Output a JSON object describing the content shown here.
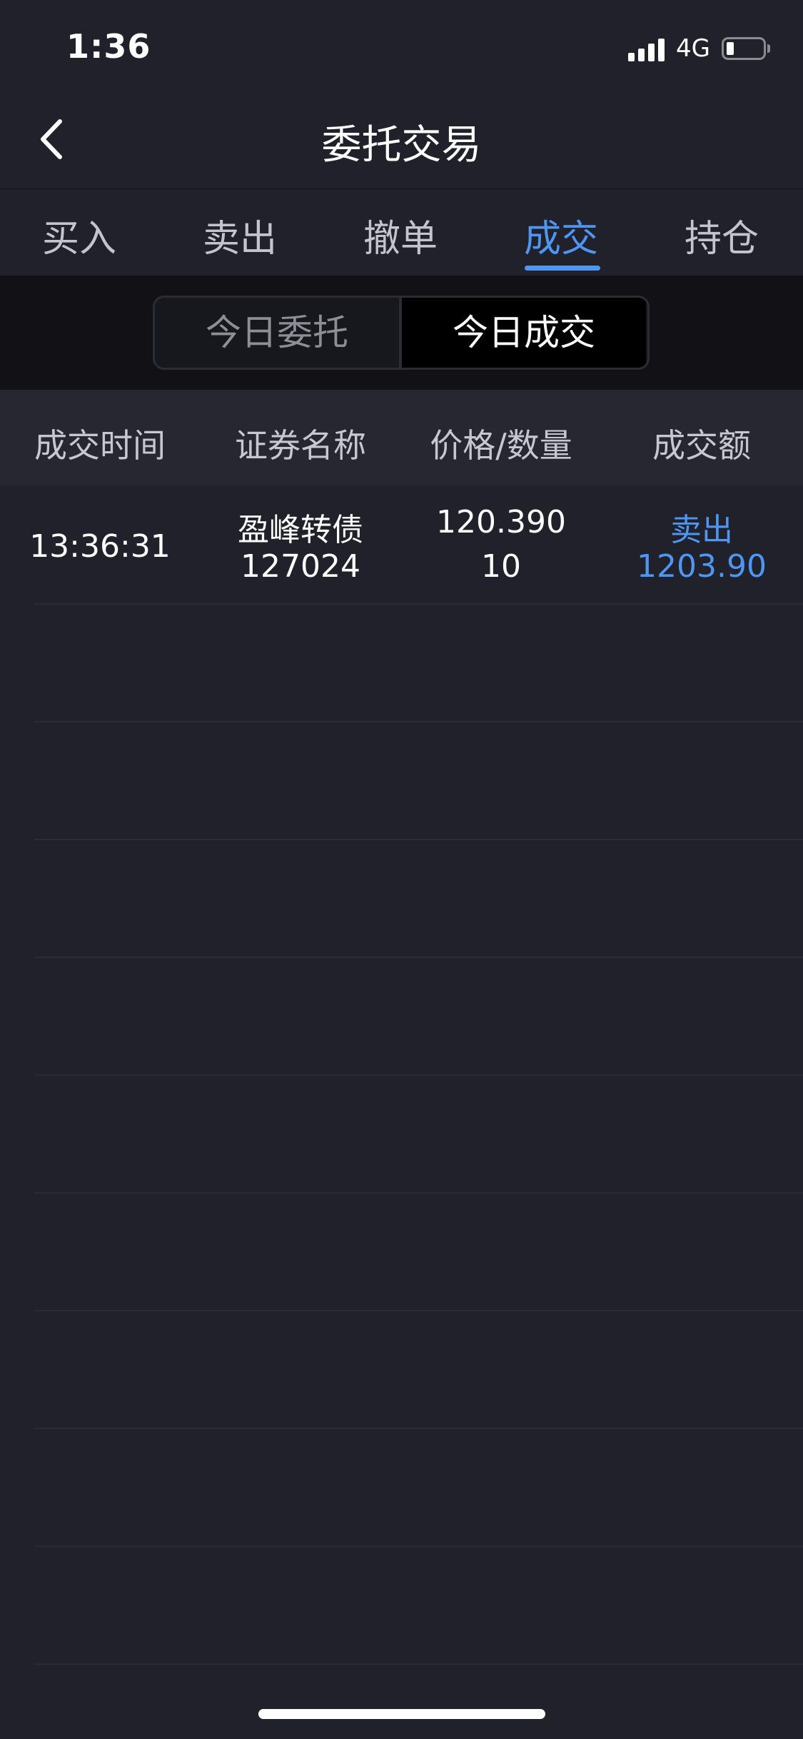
{
  "status_bar": {
    "time": "1:36",
    "network": "4G",
    "battery_fraction": 0.15
  },
  "nav": {
    "title": "委托交易"
  },
  "tabs": [
    {
      "label": "买入",
      "active": false
    },
    {
      "label": "卖出",
      "active": false
    },
    {
      "label": "撤单",
      "active": false
    },
    {
      "label": "成交",
      "active": true
    },
    {
      "label": "持仓",
      "active": false
    }
  ],
  "segment": {
    "left": "今日委托",
    "right": "今日成交",
    "selected": "今日成交"
  },
  "table": {
    "headers": [
      "成交时间",
      "证券名称",
      "价格/数量",
      "成交额"
    ],
    "rows": [
      {
        "time": "13:36:31",
        "name": "盈峰转债",
        "code": "127024",
        "price": "120.390",
        "quantity": "10",
        "side": "卖出",
        "amount": "1203.90"
      }
    ]
  },
  "colors": {
    "accent": "#4e96f0",
    "background": "#20212b",
    "header": "#262730"
  }
}
